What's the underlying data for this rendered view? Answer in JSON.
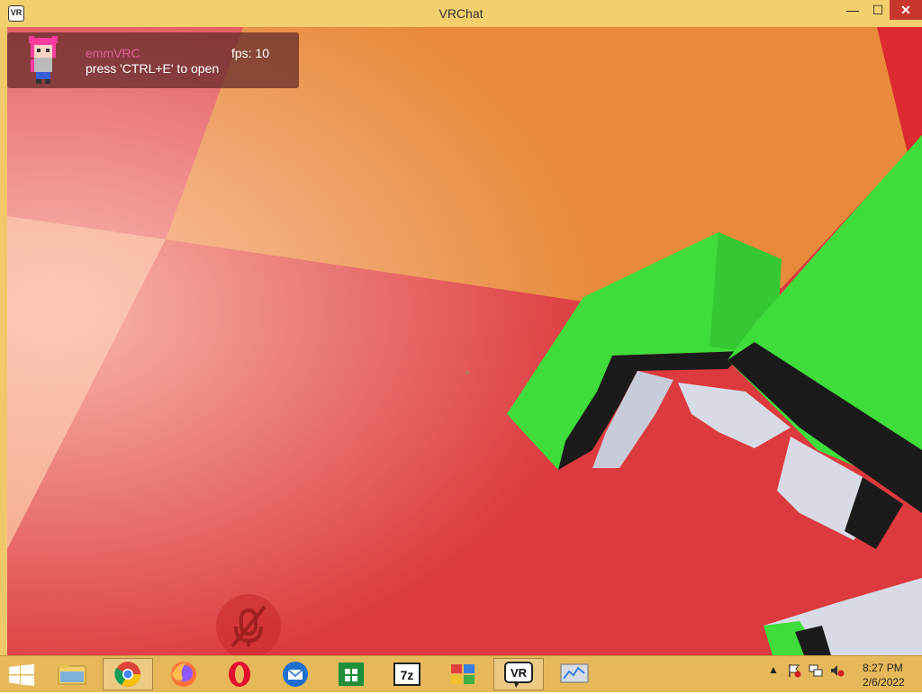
{
  "window": {
    "title": "VRChat",
    "app_icon_label": "VR",
    "controls": {
      "minimize": "—",
      "maximize": "☐",
      "close": "✕"
    }
  },
  "hud": {
    "name": "emmVRC",
    "fps": "fps: 10",
    "hint": "press 'CTRL+E' to open"
  },
  "taskbar": {
    "apps": [
      {
        "name": "file-explorer",
        "icon": "folder-icon"
      },
      {
        "name": "chrome",
        "icon": "chrome-icon",
        "active": true
      },
      {
        "name": "firefox",
        "icon": "firefox-icon"
      },
      {
        "name": "opera",
        "icon": "opera-icon"
      },
      {
        "name": "thunderbird",
        "icon": "thunderbird-icon"
      },
      {
        "name": "store",
        "icon": "store-icon"
      },
      {
        "name": "7zip",
        "icon": "7zip-icon"
      },
      {
        "name": "control-panel",
        "icon": "control-panel-icon"
      },
      {
        "name": "vrchat",
        "icon": "vrchat-icon",
        "active": true
      },
      {
        "name": "resource-monitor",
        "icon": "monitor-icon"
      }
    ],
    "seven_zip_label": "7z",
    "vrchat_label": "VR",
    "tray": {
      "show_hidden": "▲"
    },
    "clock": {
      "time": "8:27 PM",
      "date": "2/6/2022"
    }
  },
  "colors": {
    "titlebar": "#f3cf6e",
    "floor_red": "#dc3a3e",
    "floor_orange": "#e88a3a",
    "avatar_green": "#40dc3c",
    "hud_name": "#e0609a"
  }
}
